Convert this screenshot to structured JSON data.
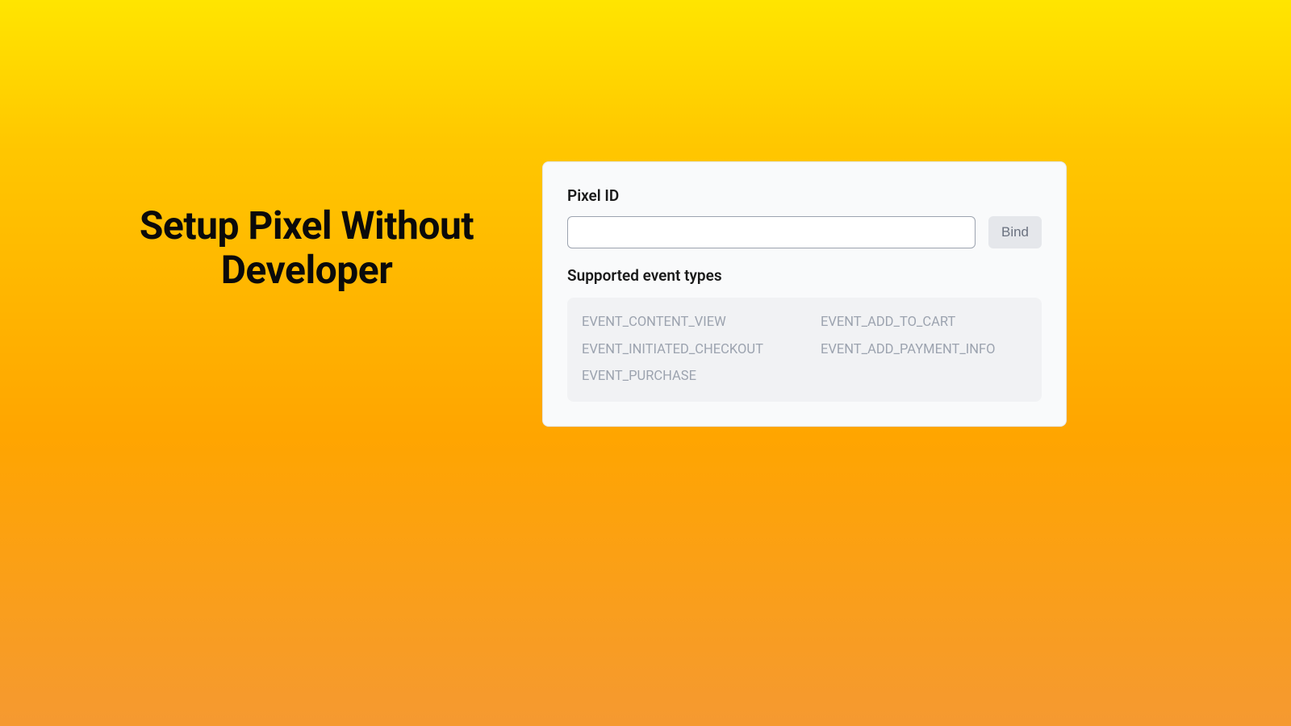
{
  "heading": "Setup Pixel Without Developer",
  "card": {
    "pixel_id_label": "Pixel ID",
    "pixel_id_value": "",
    "bind_button_label": "Bind",
    "supported_label": "Supported event types",
    "events": [
      "EVENT_CONTENT_VIEW",
      "EVENT_ADD_TO_CART",
      "EVENT_INITIATED_CHECKOUT",
      "EVENT_ADD_PAYMENT_INFO",
      "EVENT_PURCHASE"
    ]
  }
}
